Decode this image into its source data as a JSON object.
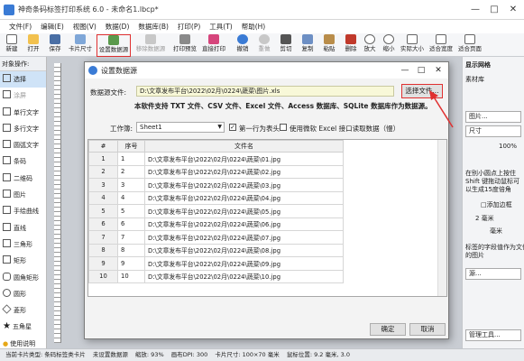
{
  "app": {
    "title": "神奇条码标签打印系统 6.0 - 未命名1.lbcp*",
    "menu": [
      "文件(F)",
      "编辑(E)",
      "视图(V)",
      "数据(D)",
      "数据库(B)",
      "打印(P)",
      "工具(T)",
      "帮助(H)"
    ]
  },
  "toolbar": [
    "新建",
    "打开",
    "保存",
    "卡片尺寸",
    "设置数据源",
    "移除数据源",
    "打印预览",
    "直接打印",
    "撤销",
    "重做",
    "剪切",
    "复制",
    "粘贴",
    "删除",
    "放大",
    "缩小",
    "实际大小",
    "适合宽度",
    "适合页面"
  ],
  "left_panel": {
    "header": "对象操作:",
    "items": [
      "选择",
      "涂屏",
      "单行文字",
      "多行文字",
      "圆弧文字",
      "条码",
      "二维码",
      "图片",
      "手绘曲线",
      "直线",
      "三角形",
      "矩形",
      "圆角矩形",
      "圆形",
      "菱形",
      "五角星",
      "使用说明"
    ]
  },
  "right_panel": {
    "tab1": "显示网格",
    "tab2": "素材库",
    "lines": [
      "图片...",
      "尺寸",
      "100%",
      "在别小圆点上按住",
      "Shift 键拖动鼠标可",
      "以生成15度倍角",
      "□添加边框",
      "2 毫米",
      "毫米",
      "标签的字段值作为文件",
      "的图片",
      "源...",
      "管理工具..."
    ]
  },
  "dialog": {
    "title": "设置数据源",
    "source_label": "数据源文件:",
    "source_path": "D:\\文章发布平台\\2022\\02月\\0224\\蔬菜\\图片.xls",
    "choose_button": "选择文件...",
    "note": "本软件支持 TXT 文件、CSV 文件、Excel 文件、Access 数据库、SQLite 数据库作为数据源。",
    "sheet_label": "工作簿:",
    "sheet_value": "Sheet1",
    "first_row_header": "第一行为表头",
    "use_excel_interface": "使用微软 Excel 接口读取数据（慢）",
    "first_row_checked": "✓",
    "columns": [
      "#",
      "序号",
      "文件名"
    ],
    "rows": [
      {
        "n": "1",
        "seq": "1",
        "file": "D:\\文章发布平台\\2022\\02月\\0224\\蔬菜\\01.jpg"
      },
      {
        "n": "2",
        "seq": "2",
        "file": "D:\\文章发布平台\\2022\\02月\\0224\\蔬菜\\02.jpg"
      },
      {
        "n": "3",
        "seq": "3",
        "file": "D:\\文章发布平台\\2022\\02月\\0224\\蔬菜\\03.jpg"
      },
      {
        "n": "4",
        "seq": "4",
        "file": "D:\\文章发布平台\\2022\\02月\\0224\\蔬菜\\04.jpg"
      },
      {
        "n": "5",
        "seq": "5",
        "file": "D:\\文章发布平台\\2022\\02月\\0224\\蔬菜\\05.jpg"
      },
      {
        "n": "6",
        "seq": "6",
        "file": "D:\\文章发布平台\\2022\\02月\\0224\\蔬菜\\06.jpg"
      },
      {
        "n": "7",
        "seq": "7",
        "file": "D:\\文章发布平台\\2022\\02月\\0224\\蔬菜\\07.jpg"
      },
      {
        "n": "8",
        "seq": "8",
        "file": "D:\\文章发布平台\\2022\\02月\\0224\\蔬菜\\08.jpg"
      },
      {
        "n": "9",
        "seq": "9",
        "file": "D:\\文章发布平台\\2022\\02月\\0224\\蔬菜\\09.jpg"
      },
      {
        "n": "10",
        "seq": "10",
        "file": "D:\\文章发布平台\\2022\\02月\\0224\\蔬菜\\10.jpg"
      }
    ],
    "ok": "确定",
    "cancel": "取消"
  },
  "status": [
    "当前卡片类型: 条码标签类卡片",
    "未设置数据源",
    "缩放: 93%",
    "画布DPI: 300",
    "卡片尺寸: 100×70 毫米",
    "鼠标位置: 9.2 毫米, 3.0"
  ],
  "colors": {
    "highlight": "#e03030",
    "accent": "#3a7bd5"
  }
}
